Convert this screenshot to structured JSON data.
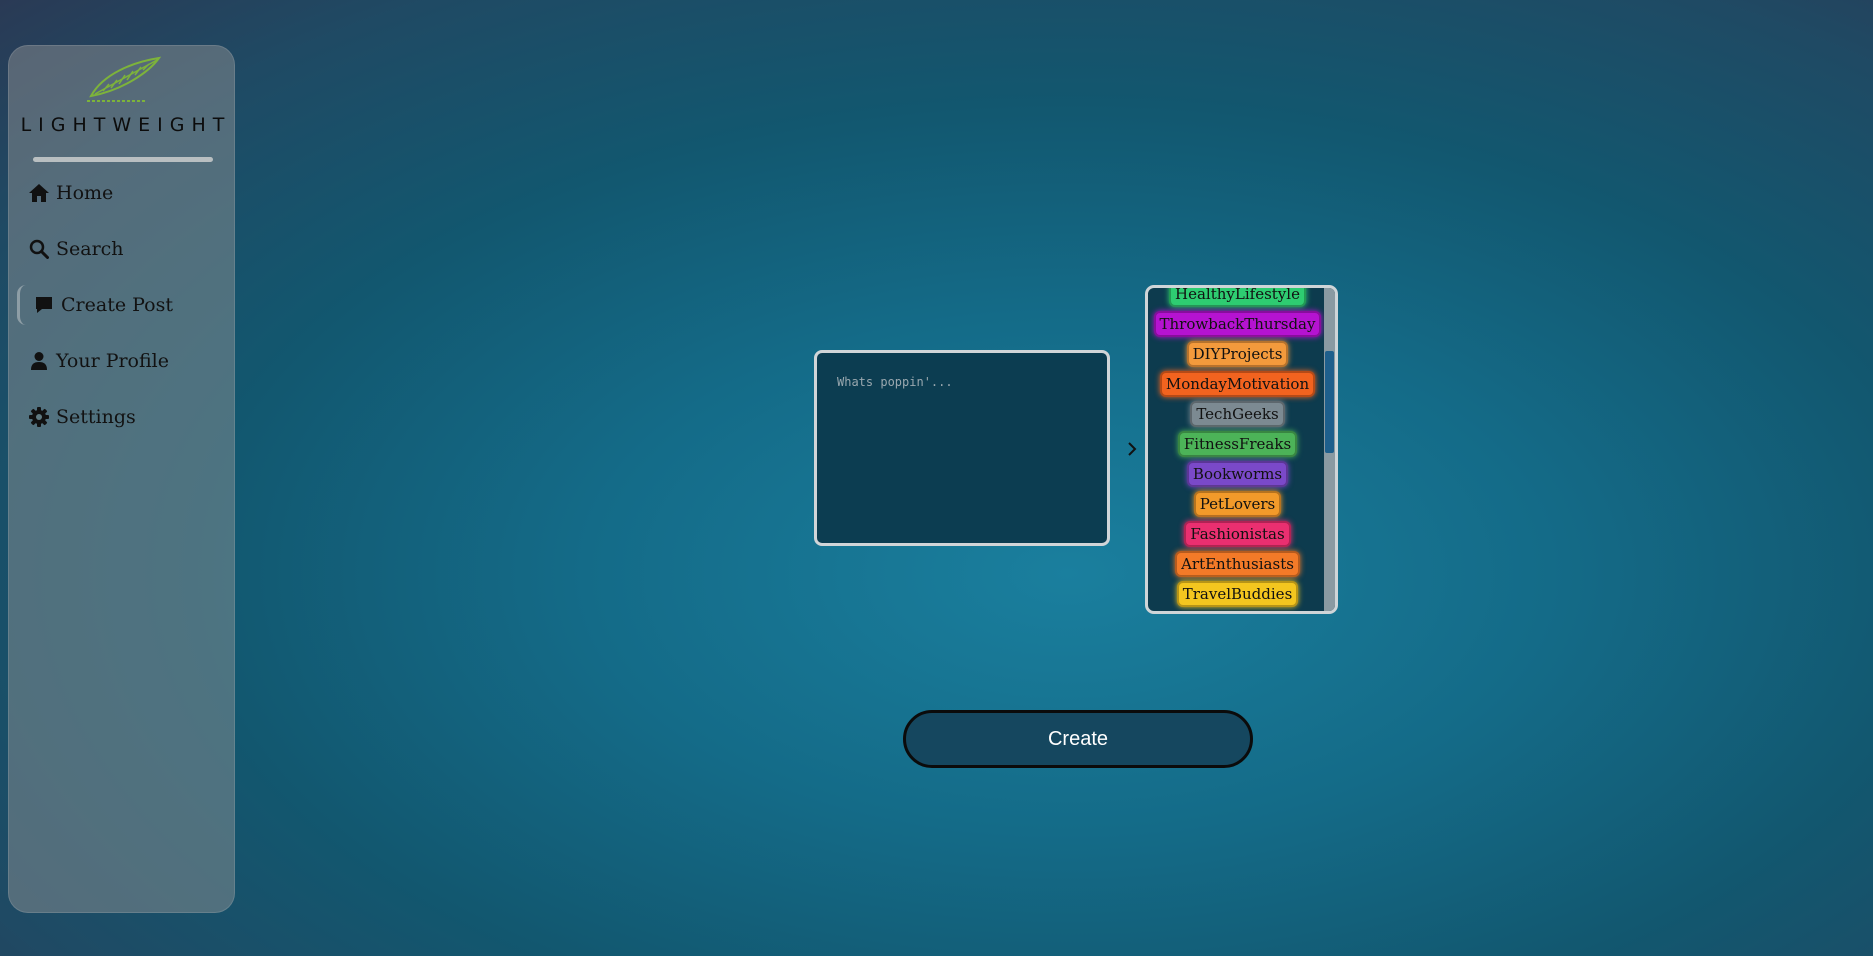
{
  "sidebar": {
    "brand": "LIGHTWEIGHT",
    "items": [
      {
        "label": "Home",
        "icon": "home-icon"
      },
      {
        "label": "Search",
        "icon": "search-icon"
      },
      {
        "label": "Create Post",
        "icon": "comment-icon",
        "active": true
      },
      {
        "label": "Your Profile",
        "icon": "user-icon"
      },
      {
        "label": "Settings",
        "icon": "gear-icon"
      }
    ]
  },
  "composer": {
    "placeholder": "Whats poppin'..."
  },
  "tags": [
    {
      "label": "HealthyLifestyle",
      "color": "#2ecc71"
    },
    {
      "label": "ThrowbackThursday",
      "color": "#b513d1"
    },
    {
      "label": "DIYProjects",
      "color": "#f39a3c"
    },
    {
      "label": "MondayMotivation",
      "color": "#f2631f"
    },
    {
      "label": "TechGeeks",
      "color": "#7c8a92"
    },
    {
      "label": "FitnessFreaks",
      "color": "#4cb358"
    },
    {
      "label": "Bookworms",
      "color": "#7a49c9"
    },
    {
      "label": "PetLovers",
      "color": "#f29a2a"
    },
    {
      "label": "Fashionistas",
      "color": "#ea2f70"
    },
    {
      "label": "ArtEnthusiasts",
      "color": "#f37a28"
    },
    {
      "label": "TravelBuddies",
      "color": "#f4c61f"
    }
  ],
  "create_button": "Create",
  "colors": {
    "logo_green": "#7db33b",
    "button_bg": "#15475f",
    "composer_bg": "#0c3d51"
  }
}
